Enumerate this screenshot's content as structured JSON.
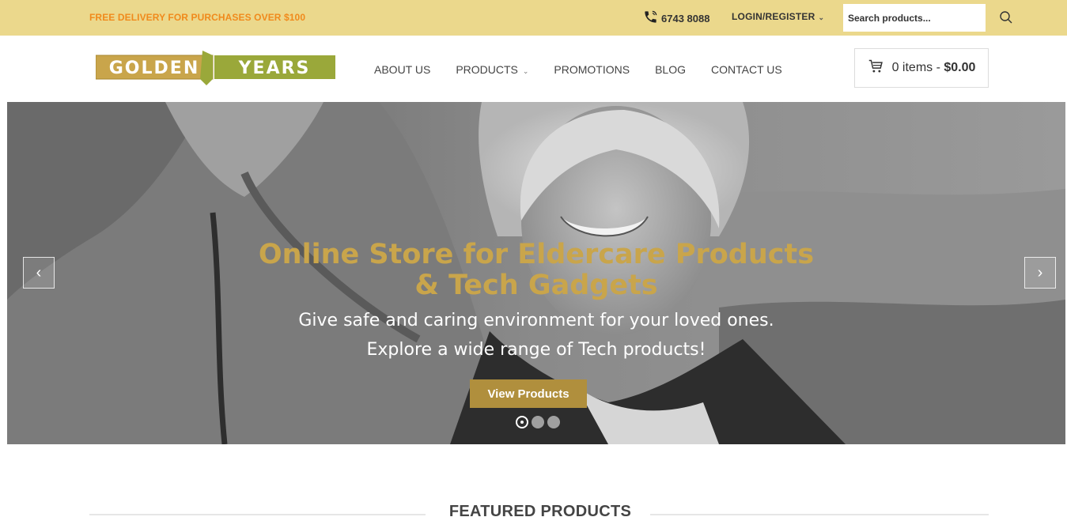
{
  "topbar": {
    "promo": "FREE DELIVERY FOR PURCHASES OVER $100",
    "phone": "6743 8088",
    "login": "LOGIN/REGISTER",
    "search_placeholder": "Search products..."
  },
  "header": {
    "logo_text": "GOLDEN YEARS",
    "nav": [
      {
        "label": "ABOUT US"
      },
      {
        "label": "PRODUCTS",
        "has_dropdown": true
      },
      {
        "label": "PROMOTIONS"
      },
      {
        "label": "BLOG"
      },
      {
        "label": "CONTACT US"
      }
    ],
    "cart": {
      "items": "0 items - ",
      "total": "$0.00"
    }
  },
  "hero": {
    "title_line1": "Online Store for Eldercare Products",
    "title_line2": "& Tech Gadgets",
    "subtitle_line1": "Give safe and caring environment for your loved ones.",
    "subtitle_line2": "Explore a wide range of Tech products!",
    "button": "View Products",
    "slides": 3,
    "active_slide": 1
  },
  "featured": {
    "title": "FEATURED PRODUCTS"
  },
  "colors": {
    "topbar_bg": "#ebd88c",
    "promo": "#f08a1c",
    "accent_gold": "#c9a54b",
    "button_gold": "#b08f3d"
  },
  "icons": [
    "phone-icon",
    "search-icon",
    "cart-icon",
    "chevron-down-icon",
    "chevron-left-icon",
    "chevron-right-icon"
  ]
}
